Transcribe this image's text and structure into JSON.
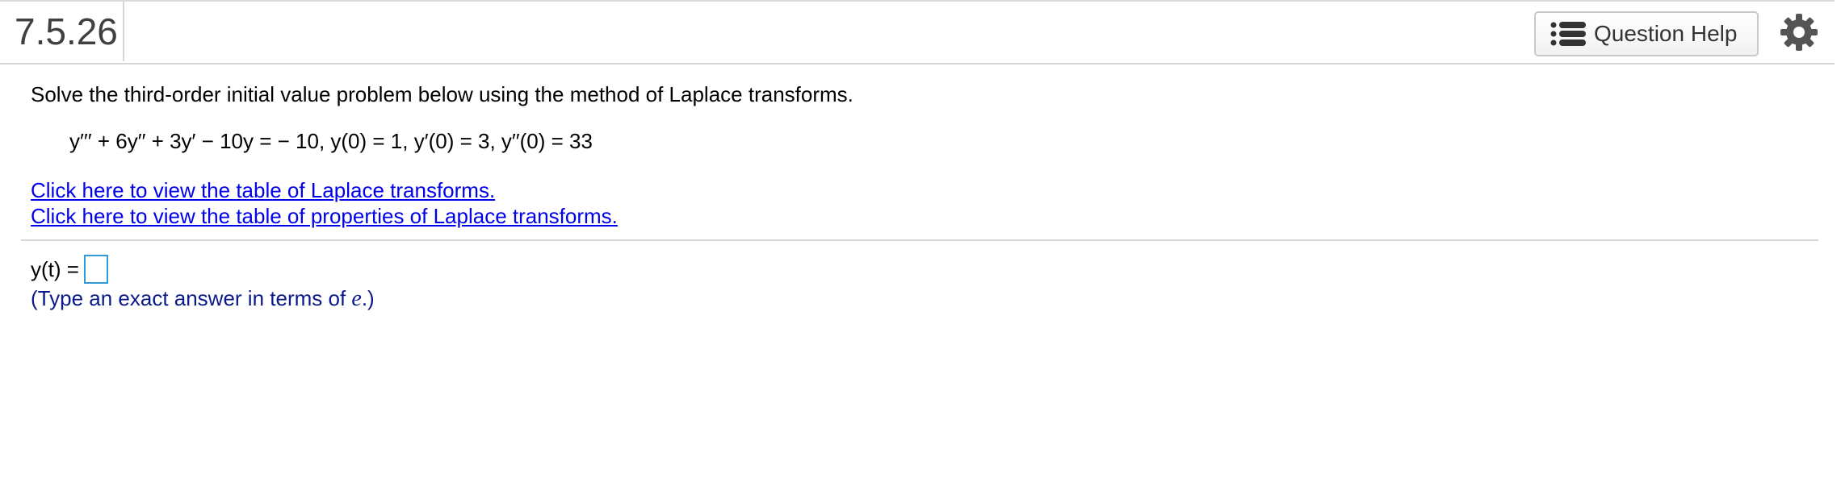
{
  "header": {
    "question_number": "7.5.26",
    "help_button_label": "Question Help",
    "help_icon": "list-icon",
    "settings_icon": "gear-icon"
  },
  "problem": {
    "prompt": "Solve the third-order initial value problem below using the method of Laplace transforms.",
    "equation": "y′′′ + 6y′′ + 3y′ − 10y =  − 10, y(0) = 1, y′(0) = 3, y′′(0) = 33"
  },
  "links": {
    "transforms_table": "Click here to view the table of Laplace transforms.",
    "properties_table": "Click here to view the table of properties of Laplace transforms."
  },
  "answer": {
    "label": "y(t) =",
    "value": "",
    "hint_prefix": "(Type an exact answer in terms of ",
    "hint_var": "e",
    "hint_suffix": ".)"
  },
  "colors": {
    "link": "#0000ee",
    "hint": "#0a1a8c",
    "input_border": "#2e9bd6"
  }
}
